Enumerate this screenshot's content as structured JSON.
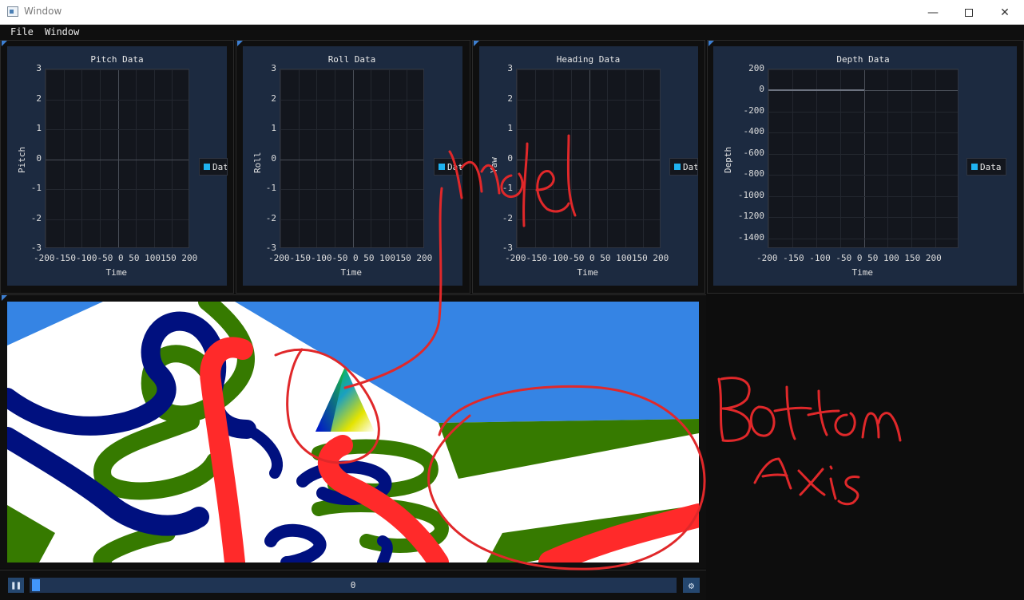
{
  "window": {
    "title": "Window",
    "controls": {
      "minimize_icon": "minimize-icon",
      "maximize_icon": "maximize-icon",
      "close_icon": "close-icon"
    }
  },
  "menu": {
    "items": [
      "File",
      "Window"
    ]
  },
  "plots": [
    {
      "title": "Pitch Data",
      "ylabel": "Pitch",
      "xlabel": "Time",
      "yticks": [
        "3",
        "2",
        "1",
        "0",
        "-1",
        "-2",
        "-3"
      ],
      "xticks_text": "-200-150-100-50  0  50 100150 200",
      "legend": "Dat"
    },
    {
      "title": "Roll Data",
      "ylabel": "Roll",
      "xlabel": "Time",
      "yticks": [
        "3",
        "2",
        "1",
        "0",
        "-1",
        "-2",
        "-3"
      ],
      "xticks_text": "-200-150-100-50  0  50 100150 200",
      "legend": "Dat"
    },
    {
      "title": "Heading Data",
      "ylabel": "Yaw",
      "xlabel": "Time",
      "yticks": [
        "3",
        "2",
        "1",
        "0",
        "-1",
        "-2",
        "-3"
      ],
      "xticks_text": "-200-150-100-50  0  50 100150 200",
      "legend": "Dat"
    },
    {
      "title": "Depth Data",
      "ylabel": "Depth",
      "xlabel": "Time",
      "yticks": [
        "200",
        "0",
        "-200",
        "-400",
        "-600",
        "-800",
        "-1000",
        "-1200",
        "-1400"
      ],
      "xticks_text": "-200 -150 -100  -50   0   50  100  150  200",
      "legend": "Data"
    }
  ],
  "chart_data": [
    {
      "type": "line",
      "title": "Pitch Data",
      "xlabel": "Time",
      "ylabel": "Pitch",
      "xlim": [
        -200,
        200
      ],
      "ylim": [
        -3,
        3
      ],
      "series": [
        {
          "name": "Data",
          "x": [],
          "y": []
        }
      ],
      "grid": true,
      "legend_position": "right"
    },
    {
      "type": "line",
      "title": "Roll Data",
      "xlabel": "Time",
      "ylabel": "Roll",
      "xlim": [
        -200,
        200
      ],
      "ylim": [
        -3,
        3
      ],
      "series": [
        {
          "name": "Data",
          "x": [],
          "y": []
        }
      ],
      "grid": true,
      "legend_position": "right"
    },
    {
      "type": "line",
      "title": "Heading Data",
      "xlabel": "Time",
      "ylabel": "Yaw",
      "xlim": [
        -200,
        200
      ],
      "ylim": [
        -3,
        3
      ],
      "series": [
        {
          "name": "Data",
          "x": [],
          "y": []
        }
      ],
      "grid": true,
      "legend_position": "right"
    },
    {
      "type": "line",
      "title": "Depth Data",
      "xlabel": "Time",
      "ylabel": "Depth",
      "xlim": [
        -200,
        200
      ],
      "ylim": [
        -1500,
        200
      ],
      "series": [
        {
          "name": "Data",
          "x": [
            -200,
            0
          ],
          "y": [
            0,
            0
          ]
        }
      ],
      "grid": true,
      "legend_position": "right"
    }
  ],
  "viewport": {
    "scene_colors": {
      "sky": "#3584e4",
      "ground": "#ffffff",
      "green_tube": "#367a00",
      "navy_tube": "#00107f",
      "red_tube": "#ff2a2a"
    },
    "model": "rgb-pyramid"
  },
  "playback": {
    "pause_icon": "pause-icon",
    "slider_value": "0",
    "slider_fraction": 0,
    "settings_icon": "gear-icon"
  },
  "annotations": {
    "ink_color": "#e0282a",
    "model_note": "model",
    "axis_note": "Bottom Axis"
  },
  "colors": {
    "accent": "#4296fa",
    "panel": "#1c2a40",
    "legend_swatch": "#1fb2f0"
  }
}
